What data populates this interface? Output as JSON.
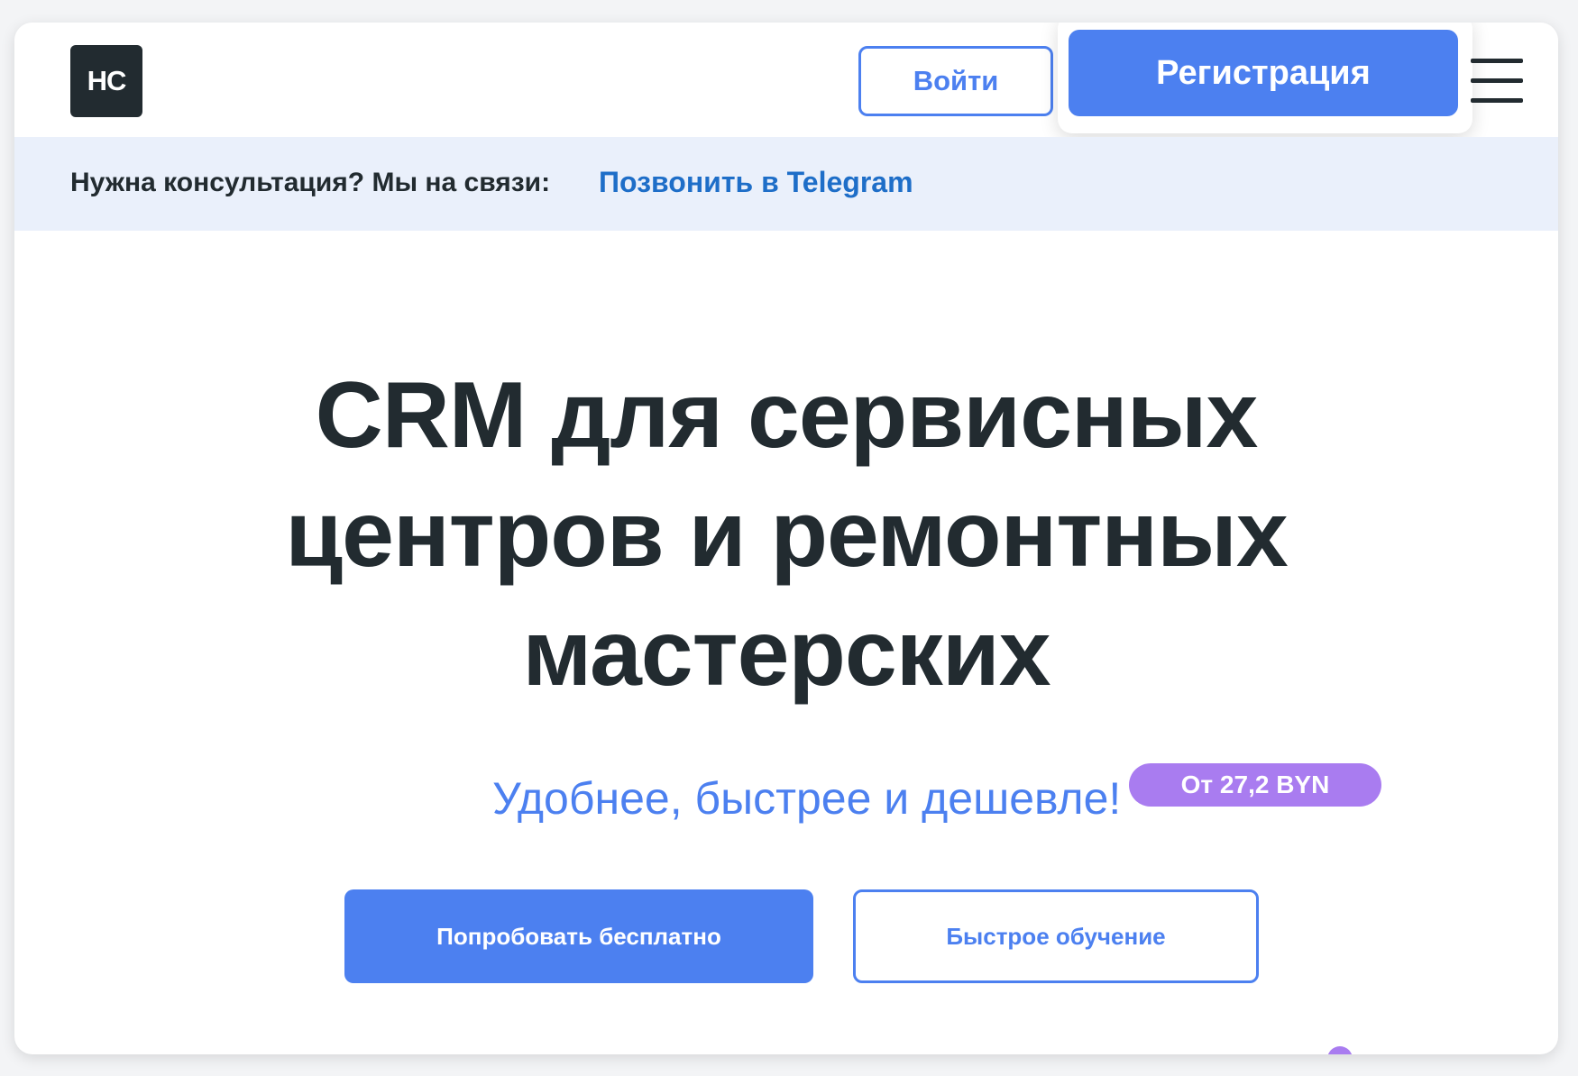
{
  "header": {
    "logo_text": "НС",
    "login_label": "Войти",
    "register_label": "Регистрация",
    "menu_icon": "hamburger-menu-icon"
  },
  "consult_bar": {
    "text": "Нужна консультация? Мы на связи:",
    "link_label": "Позвонить в Telegram"
  },
  "hero": {
    "title_lines": [
      "CRM для сервисных",
      "центров и ремонтных",
      "мастерских"
    ],
    "subtitle": "Удобнее, быстрее и дешевле!",
    "price_badge": "От 27,2 BYN",
    "primary_cta": "Попробовать бесплатно",
    "secondary_cta": "Быстрое обучение"
  },
  "colors": {
    "accent_blue": "#4c80f0",
    "dark_text": "#222b30",
    "link_blue": "#1e6ec8",
    "consult_bg": "#eaf0fb",
    "badge_purple": "#a97cf0"
  }
}
